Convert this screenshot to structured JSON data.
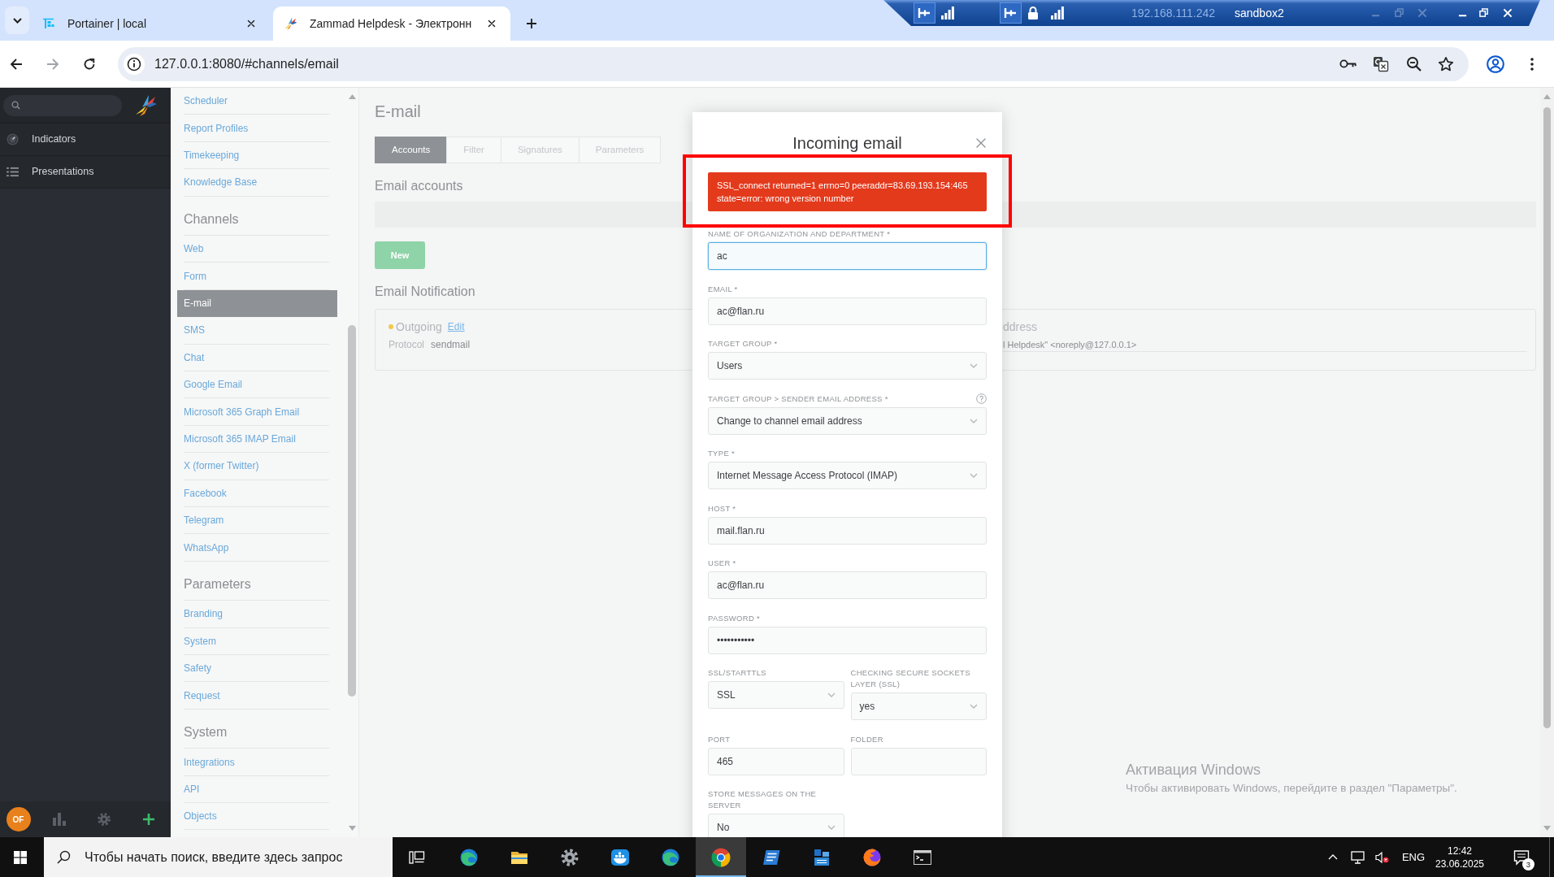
{
  "browser": {
    "tabs": [
      {
        "title": "Portainer | local",
        "selected": false
      },
      {
        "title": "Zammad Helpdesk - Электронн",
        "selected": true
      }
    ],
    "url": "127.0.0.1:8080/#channels/email"
  },
  "remote_session": {
    "address": "192.168.111.242",
    "name": "sandbox2"
  },
  "nav": {
    "items": [
      {
        "label": "Indicators",
        "kind": "gauge",
        "selected": false
      },
      {
        "label": "Presentations",
        "kind": "list",
        "selected": false
      }
    ],
    "avatar": "OF"
  },
  "settings_menu": {
    "groups": [
      {
        "items": [
          {
            "label": "Scheduler",
            "selected": false
          },
          {
            "label": "Report Profiles",
            "selected": false
          },
          {
            "label": "Timekeeping",
            "selected": false
          },
          {
            "label": "Knowledge Base",
            "selected": false
          }
        ]
      },
      {
        "heading": "Channels",
        "items": [
          {
            "label": "Web",
            "selected": false
          },
          {
            "label": "Form",
            "selected": false
          },
          {
            "label": "E-mail",
            "selected": true
          },
          {
            "label": "SMS",
            "selected": false
          },
          {
            "label": "Chat",
            "selected": false
          },
          {
            "label": "Google Email",
            "selected": false
          },
          {
            "label": "Microsoft 365 Graph Email",
            "selected": false
          },
          {
            "label": "Microsoft 365 IMAP Email",
            "selected": false
          },
          {
            "label": "X (former Twitter)",
            "selected": false
          },
          {
            "label": "Facebook",
            "selected": false
          },
          {
            "label": "Telegram",
            "selected": false
          },
          {
            "label": "WhatsApp",
            "selected": false
          }
        ]
      },
      {
        "heading": "Parameters",
        "items": [
          {
            "label": "Branding",
            "selected": false
          },
          {
            "label": "System",
            "selected": false
          },
          {
            "label": "Safety",
            "selected": false
          },
          {
            "label": "Request",
            "selected": false
          }
        ]
      },
      {
        "heading": "System",
        "items": [
          {
            "label": "Integrations",
            "selected": false
          },
          {
            "label": "API",
            "selected": false
          },
          {
            "label": "Objects",
            "selected": false
          }
        ]
      }
    ]
  },
  "page": {
    "title": "E-mail",
    "tabs": [
      {
        "label": "Accounts",
        "selected": true
      },
      {
        "label": "Filter",
        "selected": false
      },
      {
        "label": "Signatures",
        "selected": false
      },
      {
        "label": "Parameters",
        "selected": false
      }
    ],
    "accounts_heading": "Email accounts",
    "new_button": "New",
    "notification_heading": "Email Notification",
    "notification": {
      "status": "Outgoing",
      "edit_link": "Edit",
      "protocol_label": "Protocol",
      "protocol": "sendmail",
      "column_2_heading": "ddress",
      "column_2_value": "l Helpdesk\" <noreply@127.0.0.1>"
    }
  },
  "modal": {
    "title": "Incoming email",
    "alert": {
      "text": "SSL_connect returned=1 errno=0 peeraddr=83.69.193.154:465 state=error: wrong version number",
      "highlighted": true
    },
    "fields": [
      {
        "label": "NAME OF ORGANIZATION AND DEPARTMENT *",
        "kind": "text",
        "value": "ac",
        "focused": true
      },
      {
        "label": "EMAIL *",
        "kind": "text",
        "value": "ac@flan.ru",
        "focused": false
      },
      {
        "label": "TARGET GROUP *",
        "kind": "select",
        "value": "Users",
        "focused": false
      },
      {
        "label": "TARGET GROUP > SENDER EMAIL ADDRESS *",
        "kind": "select",
        "value": "Change to channel email address",
        "focused": false,
        "help": true
      },
      {
        "label": "TYPE *",
        "kind": "select",
        "value": "Internet Message Access Protocol (IMAP)",
        "focused": false
      },
      {
        "label": "HOST *",
        "kind": "text",
        "value": "mail.flan.ru",
        "focused": false
      },
      {
        "label": "USER *",
        "kind": "text",
        "value": "ac@flan.ru",
        "focused": false
      },
      {
        "label": "PASSWORD *",
        "kind": "password",
        "value": "•••••••••••",
        "focused": false
      }
    ],
    "pair_fields": [
      {
        "label": "SSL/STARTTLS",
        "kind": "select",
        "value": "SSL",
        "focused": false
      },
      {
        "label": "CHECKING SECURE SOCKETS LAYER (SSL)",
        "kind": "select",
        "value": "yes",
        "focused": false
      },
      {
        "label": "PORT",
        "kind": "text",
        "value": "465",
        "focused": false
      },
      {
        "label": "FOLDER",
        "kind": "text",
        "focused": false
      },
      {
        "label": "STORE MESSAGES ON THE SERVER",
        "kind": "select",
        "value": "No",
        "focused": false
      }
    ]
  },
  "activation_notice": {
    "title": "Активация Windows",
    "text": "Чтобы активировать Windows, перейдите в раздел \"Параметры\"."
  },
  "taskbar": {
    "search": {
      "placeholder": "Чтобы начать поиск, введите здесь запрос"
    },
    "apps": [
      {
        "kind": "swirl",
        "selected": false
      },
      {
        "kind": "folder",
        "selected": false
      },
      {
        "kind": "gear",
        "selected": false
      },
      {
        "kind": "whale",
        "selected": false
      },
      {
        "kind": "swirl",
        "selected": false
      },
      {
        "kind": "wheel",
        "selected": true
      },
      {
        "kind": "slate",
        "selected": false
      },
      {
        "kind": "cabinet",
        "selected": false
      },
      {
        "kind": "fox",
        "selected": false
      },
      {
        "kind": "terminal",
        "selected": false
      }
    ],
    "language": "ENG",
    "time": "12:42",
    "date": "23.06.2025",
    "notifications": "3"
  }
}
